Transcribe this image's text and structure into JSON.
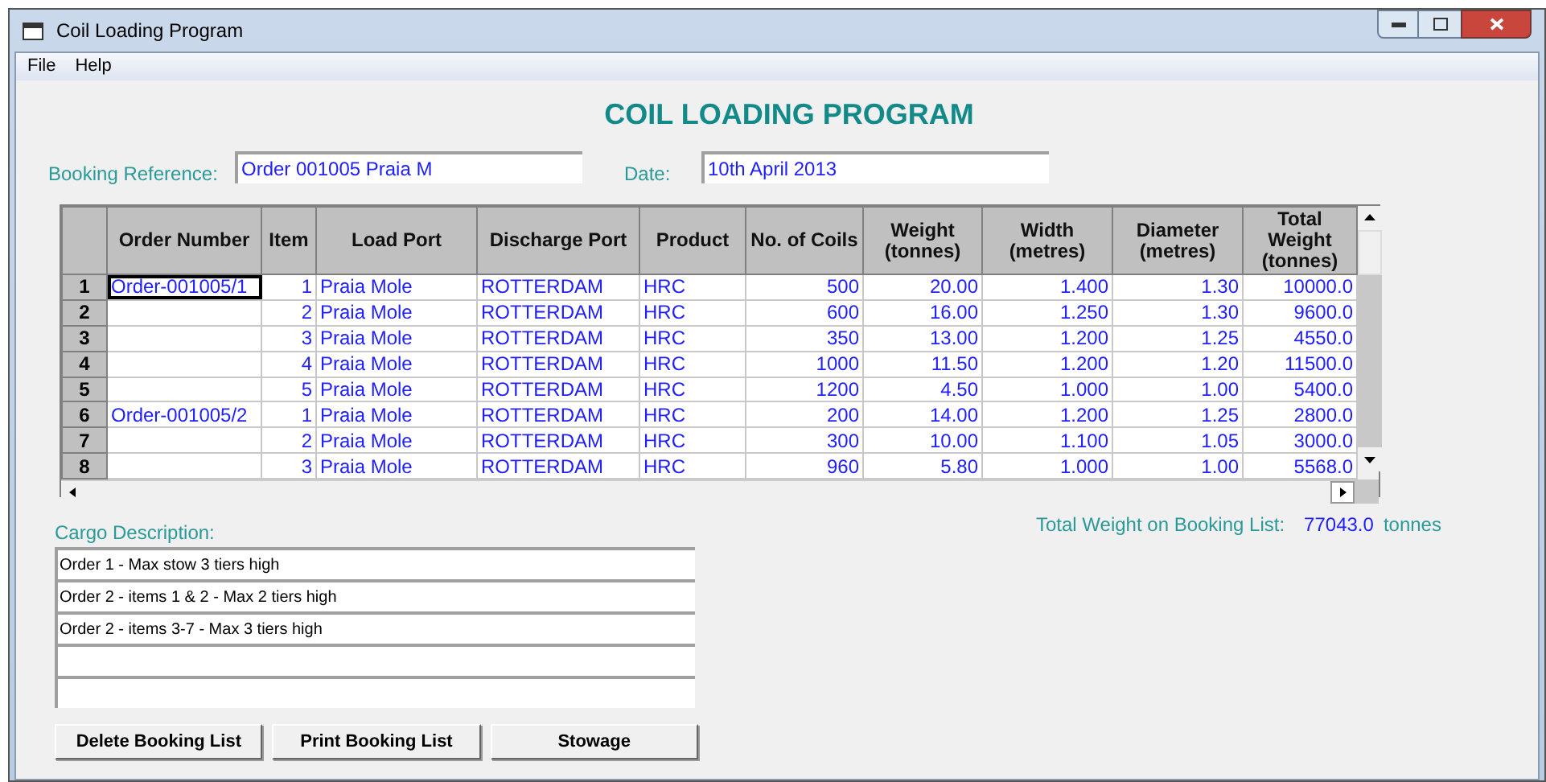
{
  "window": {
    "title": "Coil Loading Program"
  },
  "menu": [
    "File",
    "Help"
  ],
  "heading": "COIL LOADING PROGRAM",
  "booking_reference": {
    "label": "Booking Reference:",
    "value": "Order 001005 Praia M"
  },
  "date": {
    "label": "Date:",
    "value": "10th April 2013"
  },
  "table": {
    "columns": [
      "Order Number",
      "Item",
      "Load Port",
      "Discharge Port",
      "Product",
      "No. of Coils",
      "Weight (tonnes)",
      "Width (metres)",
      "Diameter (metres)",
      "Total Weight (tonnes)"
    ],
    "rows": [
      {
        "row": "1",
        "focused": true,
        "cells": [
          "Order-001005/1",
          "1",
          "Praia Mole",
          "ROTTERDAM",
          "HRC",
          "500",
          "20.00",
          "1.400",
          "1.30",
          "10000.0"
        ]
      },
      {
        "row": "2",
        "focused": false,
        "cells": [
          "",
          "2",
          "Praia Mole",
          "ROTTERDAM",
          "HRC",
          "600",
          "16.00",
          "1.250",
          "1.30",
          "9600.0"
        ]
      },
      {
        "row": "3",
        "focused": false,
        "cells": [
          "",
          "3",
          "Praia Mole",
          "ROTTERDAM",
          "HRC",
          "350",
          "13.00",
          "1.200",
          "1.25",
          "4550.0"
        ]
      },
      {
        "row": "4",
        "focused": false,
        "cells": [
          "",
          "4",
          "Praia Mole",
          "ROTTERDAM",
          "HRC",
          "1000",
          "11.50",
          "1.200",
          "1.20",
          "11500.0"
        ]
      },
      {
        "row": "5",
        "focused": false,
        "cells": [
          "",
          "5",
          "Praia Mole",
          "ROTTERDAM",
          "HRC",
          "1200",
          "4.50",
          "1.000",
          "1.00",
          "5400.0"
        ]
      },
      {
        "row": "6",
        "focused": false,
        "cells": [
          "Order-001005/2",
          "1",
          "Praia Mole",
          "ROTTERDAM",
          "HRC",
          "200",
          "14.00",
          "1.200",
          "1.25",
          "2800.0"
        ]
      },
      {
        "row": "7",
        "focused": false,
        "cells": [
          "",
          "2",
          "Praia Mole",
          "ROTTERDAM",
          "HRC",
          "300",
          "10.00",
          "1.100",
          "1.05",
          "3000.0"
        ]
      },
      {
        "row": "8",
        "focused": false,
        "cells": [
          "",
          "3",
          "Praia Mole",
          "ROTTERDAM",
          "HRC",
          "960",
          "5.80",
          "1.000",
          "1.00",
          "5568.0"
        ]
      }
    ]
  },
  "total_weight": {
    "label": "Total Weight on Booking List:",
    "value": "77043.0",
    "unit": "tonnes"
  },
  "cargo_description": {
    "label": "Cargo Description:",
    "lines": [
      "Order 1 - Max stow 3 tiers high",
      "Order 2 - items 1 & 2 - Max 2 tiers high",
      "Order 2 - items 3-7 - Max 3 tiers high"
    ]
  },
  "buttons": [
    "Delete Booking List",
    "Print Booking List",
    "Stowage"
  ]
}
